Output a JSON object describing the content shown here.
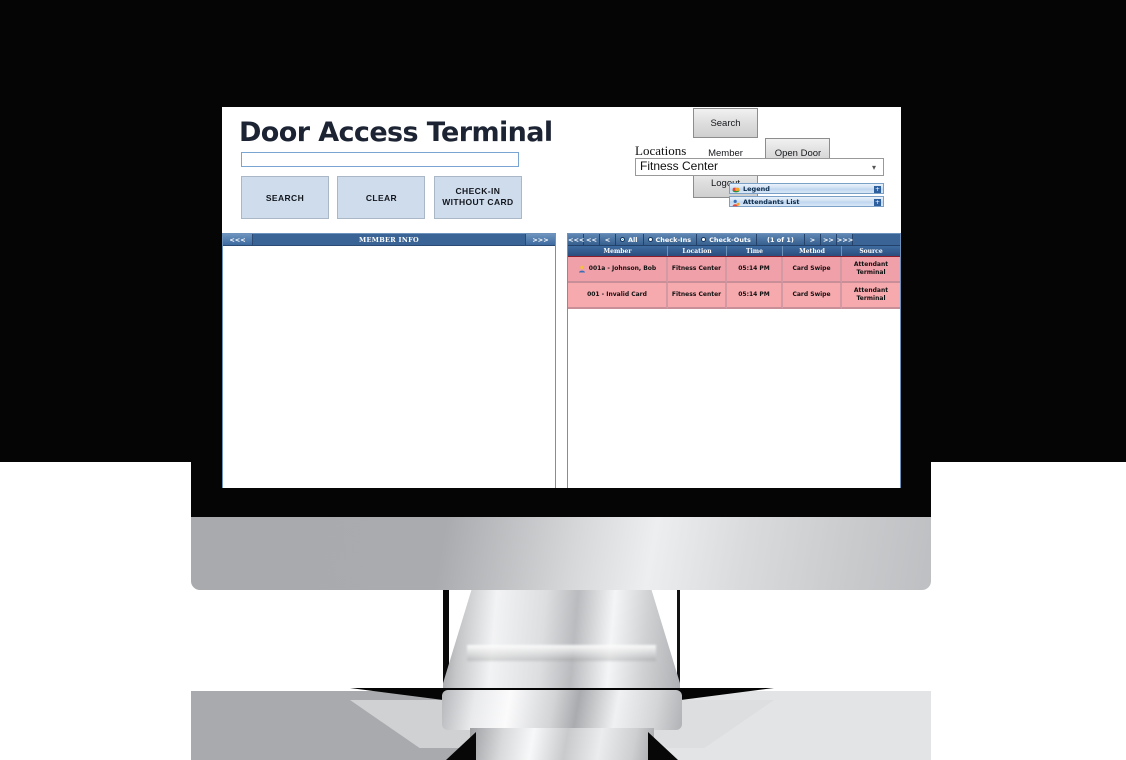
{
  "app": {
    "title": "Door Access Terminal",
    "search": {
      "value": "",
      "placeholder": ""
    },
    "buttons": {
      "search": "SEARCH",
      "clear": "CLEAR",
      "checkin_without_card": "CHECK-IN WITHOUT CARD"
    },
    "top_buttons": [
      {
        "label": "Search Member"
      },
      {
        "label": "Open Door"
      },
      {
        "label": "Logout"
      }
    ],
    "locations": {
      "label": "Locations",
      "selected": "Fitness Center",
      "options": [
        "Fitness Center"
      ]
    },
    "panels": [
      {
        "label": "Legend",
        "icon": "legend-icon",
        "expander": "+"
      },
      {
        "label": "Attendants List",
        "icon": "attendants-icon",
        "expander": "+"
      }
    ],
    "member_info": {
      "title": "MEMBER INFO",
      "prev": "<<<",
      "next": ">>>",
      "body_text": ""
    },
    "activity": {
      "nav_left": [
        "<<<",
        "<<",
        "<"
      ],
      "nav_right": [
        ">",
        ">>",
        ">>>"
      ],
      "filters": [
        {
          "label": "All",
          "selected": true
        },
        {
          "label": "Check-Ins",
          "selected": false
        },
        {
          "label": "Check-Outs",
          "selected": false
        }
      ],
      "page_indicator": "(1 of 1)",
      "columns": [
        "Member",
        "Location",
        "Time",
        "Method",
        "Source"
      ],
      "rows": [
        {
          "member": "001a - Johnson, Bob",
          "icon": "person-icon",
          "location": "Fitness Center",
          "time": "05:14 PM",
          "method": "Card Swipe",
          "source": "Attendant Terminal"
        },
        {
          "member": "001 - Invalid Card",
          "icon": "",
          "location": "Fitness Center",
          "time": "05:14 PM",
          "method": "Card Swipe",
          "source": "Attendant Terminal"
        }
      ]
    }
  },
  "colors": {
    "accent_blue": "#3b6496",
    "row_pink_1": "#efa0a8",
    "row_pink_2": "#f6aaae",
    "button_blue": "#cfdcec",
    "backdrop": "#050505"
  }
}
